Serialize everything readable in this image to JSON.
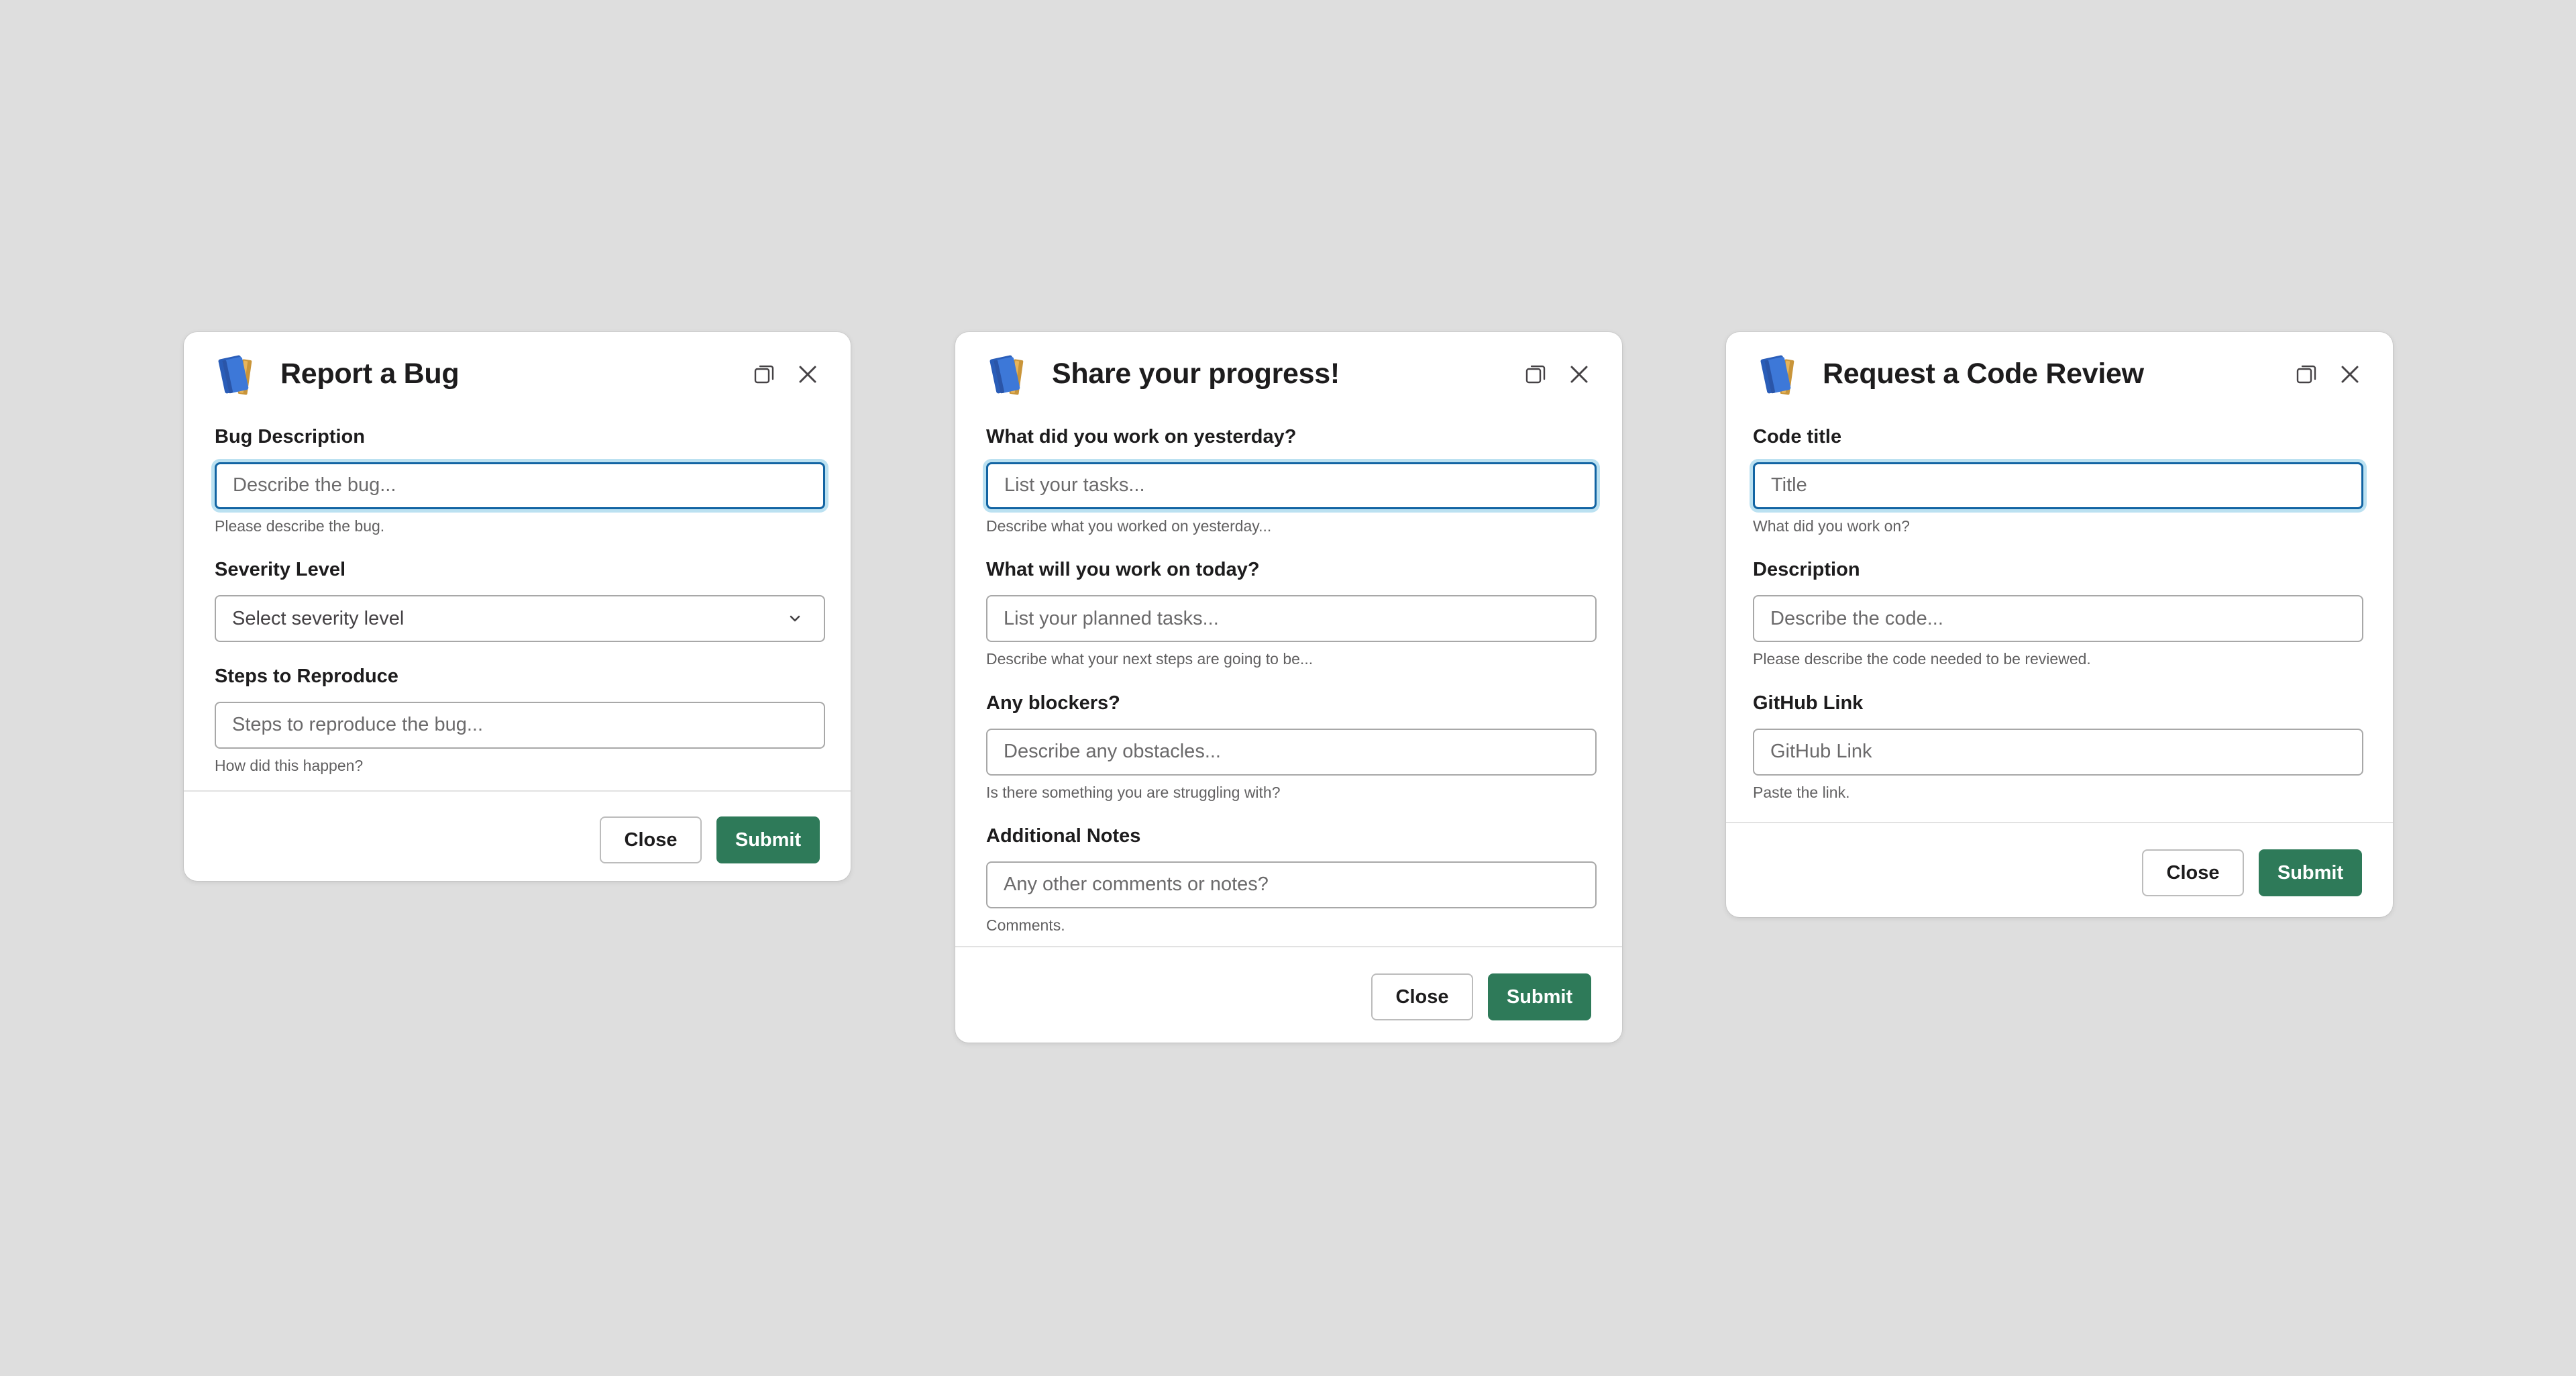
{
  "colors": {
    "background": "#dedede",
    "primary_button": "#2e7a59",
    "focus_ring": "#1264a3"
  },
  "icons": {
    "app": "notebook-icon",
    "restore": "restore-window-icon",
    "close": "close-icon",
    "dropdown": "chevron-down-icon"
  },
  "bug_modal": {
    "title": "Report a Bug",
    "fields": [
      {
        "label": "Bug Description",
        "placeholder": "Describe the bug...",
        "hint": "Please describe the bug."
      },
      {
        "label": "Severity Level",
        "selected": "Select severity level"
      },
      {
        "label": "Steps to Reproduce",
        "placeholder": "Steps to reproduce the bug...",
        "hint": "How did this happen?"
      }
    ],
    "close_label": "Close",
    "submit_label": "Submit"
  },
  "progress_modal": {
    "title": "Share your progress!",
    "fields": [
      {
        "label": "What did you work on yesterday?",
        "placeholder": "List your tasks...",
        "hint": "Describe what you worked on yesterday..."
      },
      {
        "label": "What will you work on today?",
        "placeholder": "List your planned tasks...",
        "hint": "Describe what your next steps are going to be..."
      },
      {
        "label": "Any blockers?",
        "placeholder": "Describe any obstacles...",
        "hint": "Is there something you are struggling with?"
      },
      {
        "label": "Additional Notes",
        "placeholder": "Any other comments or notes?",
        "hint": "Comments."
      }
    ],
    "close_label": "Close",
    "submit_label": "Submit"
  },
  "review_modal": {
    "title": "Request a Code Review",
    "fields": [
      {
        "label": "Code title",
        "placeholder": "Title",
        "hint": "What did you work on?"
      },
      {
        "label": "Description",
        "placeholder": "Describe the code...",
        "hint": "Please describe the code needed to be reviewed."
      },
      {
        "label": "GitHub Link",
        "placeholder": "GitHub Link",
        "hint": "Paste the link."
      }
    ],
    "close_label": "Close",
    "submit_label": "Submit"
  }
}
